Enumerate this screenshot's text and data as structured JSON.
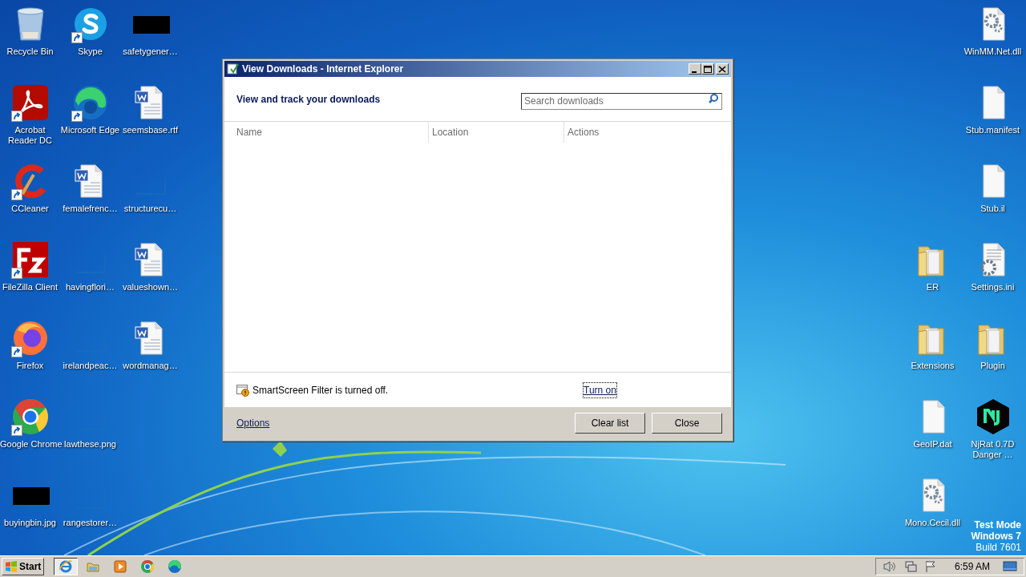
{
  "desktop": {
    "left_columns": [
      [
        {
          "label": "Recycle Bin",
          "kind": "recycle-bin",
          "shortcut": false
        },
        {
          "label": "Acrobat Reader DC",
          "kind": "acrobat",
          "shortcut": true
        },
        {
          "label": "CCleaner",
          "kind": "ccleaner",
          "shortcut": true
        },
        {
          "label": "FileZilla Client",
          "kind": "filezilla",
          "shortcut": true
        },
        {
          "label": "Firefox",
          "kind": "firefox",
          "shortcut": true
        },
        {
          "label": "Google Chrome",
          "kind": "chrome",
          "shortcut": true
        },
        {
          "label": "buyingbin.jpg",
          "kind": "black-thumb",
          "shortcut": false
        }
      ],
      [
        {
          "label": "Skype",
          "kind": "skype",
          "shortcut": true
        },
        {
          "label": "Microsoft Edge",
          "kind": "edge",
          "shortcut": true
        },
        {
          "label": "femalefrenc…",
          "kind": "word-doc",
          "shortcut": false
        },
        {
          "label": "havingflori…",
          "kind": "blank-thumb",
          "shortcut": false
        },
        {
          "label": "irelandpeac…",
          "kind": "blank-thumb",
          "shortcut": false
        },
        {
          "label": "lawthese.png",
          "kind": "blank-thumb",
          "shortcut": false
        },
        {
          "label": "rangestorer…",
          "kind": "blank-thumb",
          "shortcut": false
        }
      ],
      [
        {
          "label": "safetygener…",
          "kind": "black-thumb",
          "shortcut": false
        },
        {
          "label": "seemsbase.rtf",
          "kind": "word-doc",
          "shortcut": false
        },
        {
          "label": "structurecu…",
          "kind": "blank-thumb",
          "shortcut": false
        },
        {
          "label": "valueshown…",
          "kind": "word-doc",
          "shortcut": false
        },
        {
          "label": "wordmanag…",
          "kind": "word-doc",
          "shortcut": false
        }
      ]
    ],
    "right_columns": [
      [
        {
          "label": "ER",
          "kind": "folder",
          "shortcut": false
        },
        {
          "label": "Extensions",
          "kind": "folder",
          "shortcut": false
        },
        {
          "label": "GeoIP.dat",
          "kind": "file",
          "shortcut": false
        },
        {
          "label": "Mono.Cecil.dll",
          "kind": "gear-doc",
          "shortcut": false
        }
      ],
      [
        {
          "label": "WinMM.Net.dll",
          "kind": "gear-doc",
          "shortcut": false
        },
        {
          "label": "Stub.manifest",
          "kind": "file",
          "shortcut": false
        },
        {
          "label": "Stub.il",
          "kind": "file",
          "shortcut": false
        },
        {
          "label": "Settings.ini",
          "kind": "settings-file",
          "shortcut": false
        },
        {
          "label": "Plugin",
          "kind": "folder",
          "shortcut": false
        },
        {
          "label": "NjRat 0.7D Danger …",
          "kind": "hexagon",
          "shortcut": false
        }
      ]
    ]
  },
  "system_text": [
    {
      "text": "Test Mode",
      "bold": true
    },
    {
      "text": "Windows 7",
      "bold": true
    },
    {
      "text": "Build 7601",
      "bold": false
    }
  ],
  "dialog": {
    "title": "View Downloads - Internet Explorer",
    "heading": "View and track your downloads",
    "search": {
      "placeholder": "Search downloads"
    },
    "columns": [
      "Name",
      "Location",
      "Actions"
    ],
    "notice": {
      "message": "SmartScreen Filter is turned off.",
      "link": "Turn on"
    },
    "options_link": "Options",
    "buttons": [
      "Clear list",
      "Close"
    ]
  },
  "taskbar": {
    "start": "Start",
    "apps": [
      {
        "kind": "ie",
        "selected": true
      },
      {
        "kind": "explorer",
        "selected": false
      },
      {
        "kind": "media",
        "selected": false
      },
      {
        "kind": "chrome",
        "selected": false
      },
      {
        "kind": "edge",
        "selected": false
      }
    ],
    "clock": "6:59 AM"
  }
}
